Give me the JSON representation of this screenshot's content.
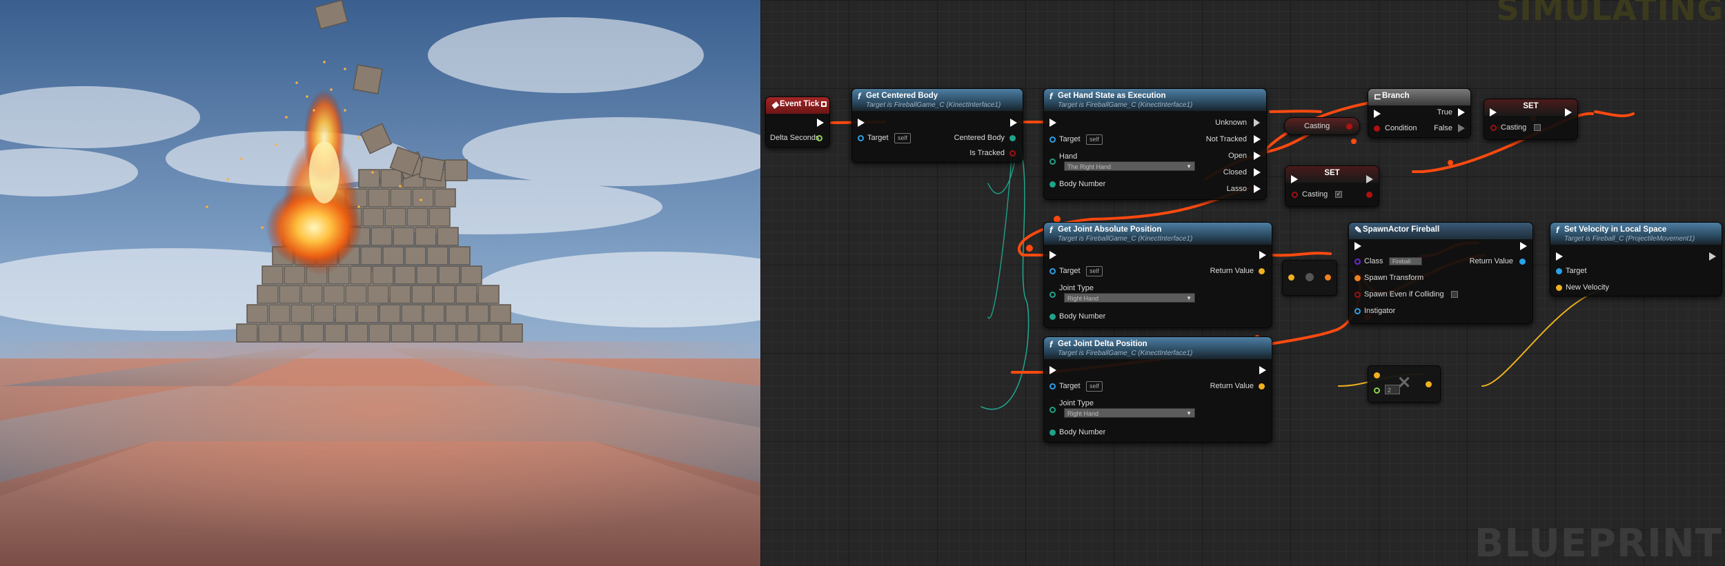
{
  "watermarks": {
    "simulating": "SIMULATING",
    "blueprint": "BLUEPRINT"
  },
  "colors": {
    "exec_wire": "#ff4a10",
    "vector_wire": "#f0b020",
    "struct_wire": "#1fa38a",
    "function_header": "#4e7ea2",
    "event_header": "#a32626"
  },
  "nodes": {
    "event_tick": {
      "title": "Event Tick",
      "pins": {
        "delta_seconds": "Delta Seconds"
      }
    },
    "get_centered_body": {
      "title": "Get Centered Body",
      "subtitle": "Target is FireballGame_C (KinectInterface1)",
      "pins": {
        "target": "Target",
        "self": "self",
        "centered_body": "Centered Body",
        "is_tracked": "Is Tracked"
      }
    },
    "get_hand_state": {
      "title": "Get Hand State as Execution",
      "subtitle": "Target is FireballGame_C (KinectInterface1)",
      "pins": {
        "target": "Target",
        "self": "self",
        "hand": "Hand",
        "hand_value": "The Right Hand",
        "body_number": "Body Number",
        "unknown": "Unknown",
        "not_tracked": "Not Tracked",
        "open": "Open",
        "closed": "Closed",
        "lasso": "Lasso"
      }
    },
    "casting_var": {
      "label": "Casting"
    },
    "branch": {
      "title": "Branch",
      "pins": {
        "condition": "Condition",
        "true": "True",
        "false": "False"
      }
    },
    "set_top": {
      "title": "SET",
      "pins": {
        "casting": "Casting"
      }
    },
    "set_mid": {
      "title": "SET",
      "pins": {
        "casting": "Casting"
      }
    },
    "get_joint_abs": {
      "title": "Get Joint Absolute Position",
      "subtitle": "Target is FireballGame_C (KinectInterface1)",
      "pins": {
        "target": "Target",
        "self": "self",
        "joint_type": "Joint Type",
        "joint_value": "Right Hand",
        "body_number": "Body Number",
        "return_value": "Return Value"
      }
    },
    "spawn_actor": {
      "title": "SpawnActor Fireball",
      "pins": {
        "class": "Class",
        "class_value": "Fireball",
        "spawn_transform": "Spawn Transform",
        "spawn_even": "Spawn Even if Colliding",
        "instigator": "Instigator",
        "return_value": "Return Value"
      }
    },
    "set_velocity": {
      "title": "Set Velocity in Local Space",
      "subtitle": "Target is Fireball_C (ProjectileMovement1)",
      "pins": {
        "target": "Target",
        "new_velocity": "New Velocity"
      }
    },
    "get_joint_delta": {
      "title": "Get Joint Delta Position",
      "subtitle": "Target is FireballGame_C (KinectInterface1)",
      "pins": {
        "target": "Target",
        "self": "self",
        "joint_type": "Joint Type",
        "joint_value": "Right Hand",
        "body_number": "Body Number",
        "return_value": "Return Value"
      }
    },
    "multiply": {
      "value": "2"
    }
  }
}
